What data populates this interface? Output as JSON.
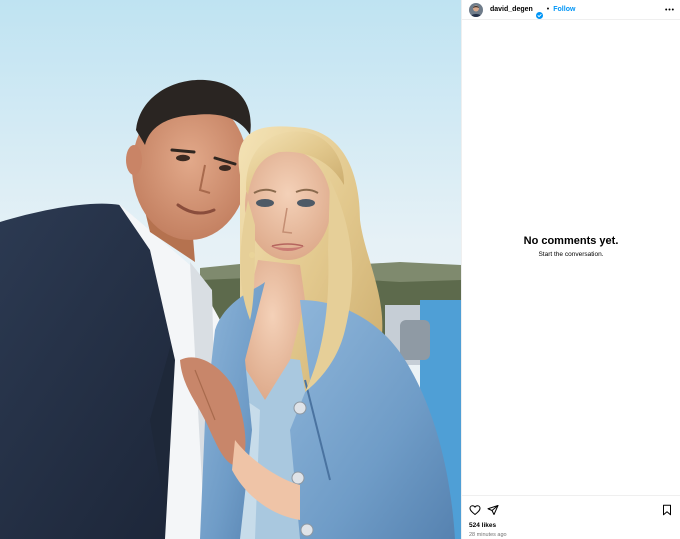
{
  "post": {
    "image_alt": "Couple posing outdoors",
    "author": {
      "username": "david_degen",
      "verified": true,
      "separator": "•",
      "follow_label": "Follow"
    },
    "comments": {
      "empty_title": "No comments yet.",
      "empty_subtitle": "Start the conversation."
    },
    "engagement": {
      "likes": "524 likes",
      "timestamp": "28 minutes ago"
    },
    "icons": {
      "like": "heart-icon",
      "share": "send-icon",
      "save": "bookmark-icon",
      "more": "more-options-icon",
      "verified": "verified-badge-icon"
    },
    "colors": {
      "link": "#0095f6",
      "verified": "#0095f6",
      "divider": "#efefef",
      "muted": "#737373"
    }
  }
}
